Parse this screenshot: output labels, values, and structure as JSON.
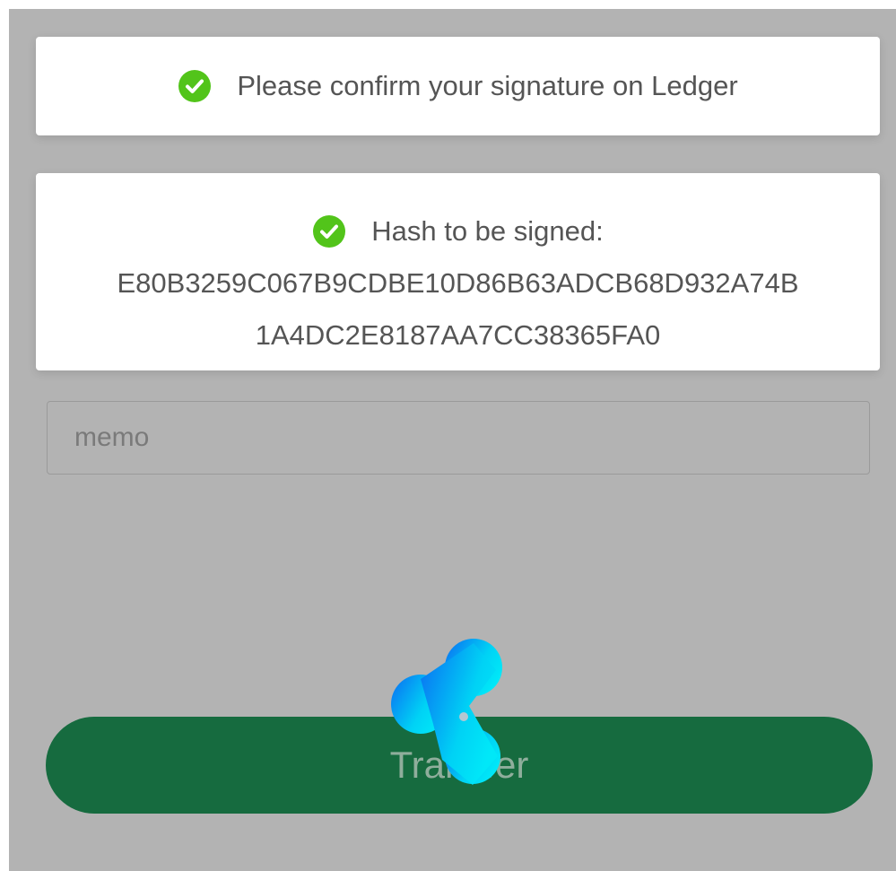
{
  "notifications": [
    {
      "message": "Please confirm your signature on Ledger"
    },
    {
      "message": "Hash to be signed:",
      "hash_line_1": "E80B3259C067B9CDBE10D86B63ADCB68D932A74B",
      "hash_line_2": "1A4DC2E8187AA7CC38365FA0"
    }
  ],
  "form": {
    "memo_placeholder": "memo",
    "memo_value": "",
    "transfer_label": "Transfer"
  },
  "colors": {
    "success_green": "#52c41a",
    "button_green": "#166b3f",
    "overlay_gray": "#b3b3b3",
    "spinner_blue": "#0b6bf2",
    "spinner_cyan": "#00e4f5"
  },
  "icons": {
    "notification_icon": "check-circle-icon",
    "loading_icon": "loading-spinner-icon"
  }
}
